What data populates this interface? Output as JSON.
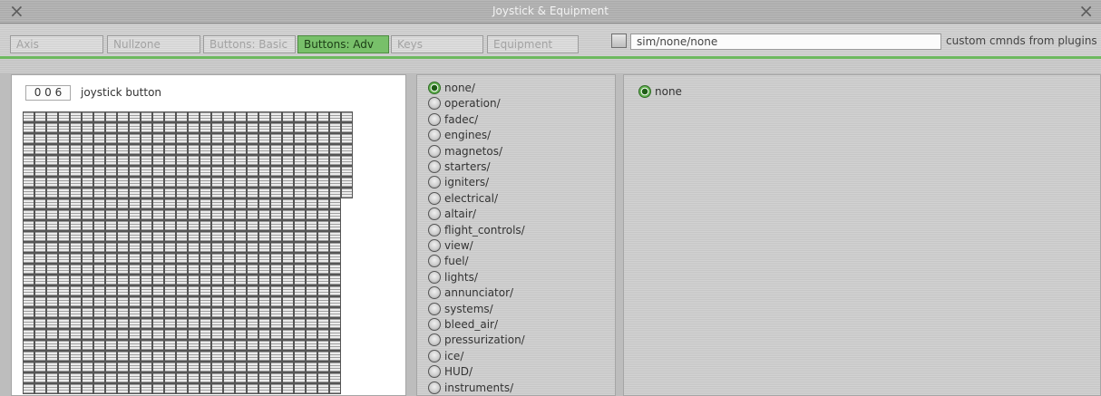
{
  "window": {
    "title": "Joystick & Equipment",
    "close_glyph": "×"
  },
  "tabs": [
    {
      "label": "Axis",
      "active": false
    },
    {
      "label": "Nullzone",
      "active": false
    },
    {
      "label": "Buttons: Basic",
      "active": false
    },
    {
      "label": "Buttons: Adv",
      "active": true
    },
    {
      "label": "Keys",
      "active": false
    },
    {
      "label": "Equipment",
      "active": false
    }
  ],
  "command_bar": {
    "custom_checked": false,
    "command_value": "sim/none/none",
    "plugins_label": "custom cmnds from plugins"
  },
  "button_selector": {
    "number": "0 0 6",
    "label": "joystick button"
  },
  "categories": [
    {
      "label": "none/",
      "checked": true
    },
    {
      "label": "operation/",
      "checked": false
    },
    {
      "label": "fadec/",
      "checked": false
    },
    {
      "label": "engines/",
      "checked": false
    },
    {
      "label": "magnetos/",
      "checked": false
    },
    {
      "label": "starters/",
      "checked": false
    },
    {
      "label": "igniters/",
      "checked": false
    },
    {
      "label": "electrical/",
      "checked": false
    },
    {
      "label": "altair/",
      "checked": false
    },
    {
      "label": "flight_controls/",
      "checked": false
    },
    {
      "label": "view/",
      "checked": false
    },
    {
      "label": "fuel/",
      "checked": false
    },
    {
      "label": "lights/",
      "checked": false
    },
    {
      "label": "annunciator/",
      "checked": false
    },
    {
      "label": "systems/",
      "checked": false
    },
    {
      "label": "bleed_air/",
      "checked": false
    },
    {
      "label": "pressurization/",
      "checked": false
    },
    {
      "label": "ice/",
      "checked": false
    },
    {
      "label": "HUD/",
      "checked": false
    },
    {
      "label": "instruments/",
      "checked": false
    }
  ],
  "commands": [
    {
      "label": "none",
      "checked": true
    }
  ],
  "colors": {
    "active_tab": "#78c06a",
    "accent_line": "#6db95f",
    "radio_checked": "#64b352"
  }
}
